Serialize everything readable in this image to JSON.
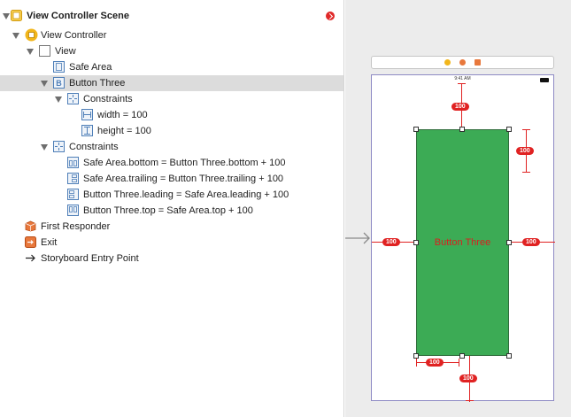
{
  "outline": {
    "rows": [
      {
        "label": "View Controller Scene"
      },
      {
        "label": "View Controller"
      },
      {
        "label": "View"
      },
      {
        "label": "Safe Area"
      },
      {
        "label": "Button Three"
      },
      {
        "label": "Constraints"
      },
      {
        "label": "width = 100"
      },
      {
        "label": "height = 100"
      },
      {
        "label": "Constraints"
      },
      {
        "label": "Safe Area.bottom = Button Three.bottom + 100"
      },
      {
        "label": "Safe Area.trailing = Button Three.trailing + 100"
      },
      {
        "label": "Button Three.leading = Safe Area.leading + 100"
      },
      {
        "label": "Button Three.top = Safe Area.top + 100"
      },
      {
        "label": "First Responder"
      },
      {
        "label": "Exit"
      },
      {
        "label": "Storyboard Entry Point"
      }
    ]
  },
  "canvas": {
    "status_time": "9:41 AM",
    "button_title": "Button Three",
    "constraint_value": "100"
  },
  "colors": {
    "selection": "#dcdcdc",
    "button_green": "#3cab55",
    "constraint_red": "#e02222",
    "icon_blue": "#4f7fb8",
    "scene_yellow": "#f2b61b"
  }
}
